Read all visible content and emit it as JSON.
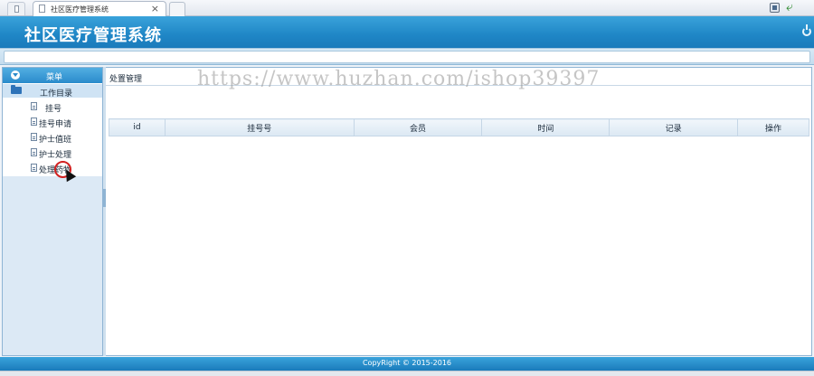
{
  "browser": {
    "tab_title": "社区医疗管理系统",
    "tab_close": "×"
  },
  "app": {
    "title": "社区医疗管理系统"
  },
  "sidebar": {
    "header_label": "菜单",
    "root_label": "工作目录",
    "items": [
      {
        "label": "挂号"
      },
      {
        "label": "挂号申请"
      },
      {
        "label": "护士值班"
      },
      {
        "label": "护士处理"
      },
      {
        "label": "处理药物"
      }
    ]
  },
  "main": {
    "breadcrumb": "处置管理",
    "watermark": "https://www.huzhan.com/ishop39397",
    "table": {
      "columns": [
        "id",
        "挂号号",
        "会员",
        "时间",
        "记录",
        "操作"
      ]
    }
  },
  "footer": {
    "copyright": "CopyRight © 2015-2016"
  }
}
